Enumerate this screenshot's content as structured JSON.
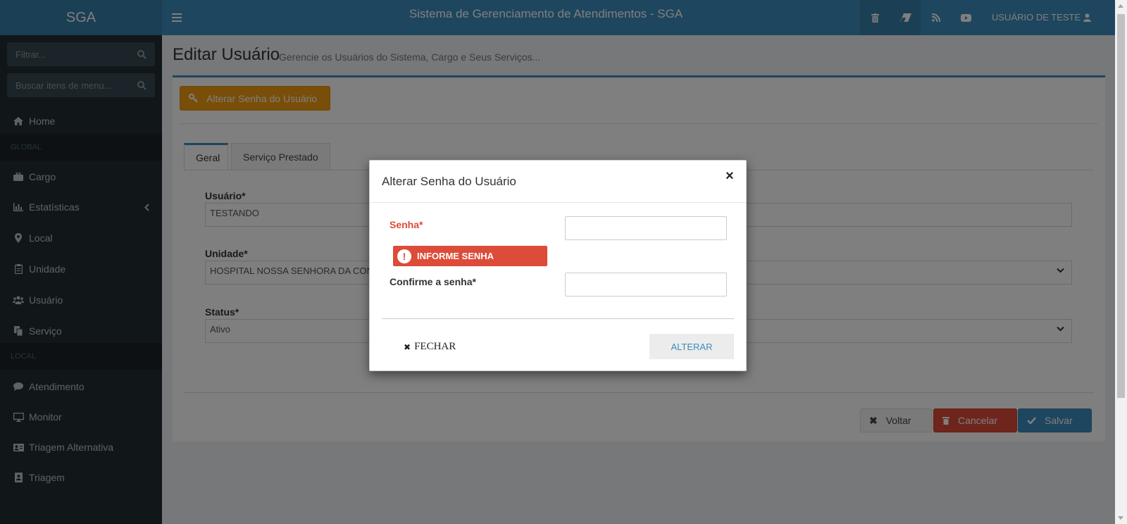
{
  "header": {
    "brand": "SGA",
    "title": "Sistema de Gerenciamento de Atendimentos - SGA",
    "user": "USUÁRIO DE TESTE",
    "icons": [
      "trash-icon",
      "eraser-icon",
      "rss-icon",
      "youtube-icon"
    ]
  },
  "sidebar": {
    "filter_placeholder": "Filtrar...",
    "search_placeholder": "Buscar itens de menu...",
    "home": "Home",
    "section_global": "GLOBAL",
    "global_items": [
      {
        "label": "Cargo",
        "icon": "briefcase-icon"
      },
      {
        "label": "Estatísticas",
        "icon": "bar-chart-icon"
      },
      {
        "label": "Local",
        "icon": "map-marker-icon"
      },
      {
        "label": "Unidade",
        "icon": "clipboard-icon"
      },
      {
        "label": "Usuário",
        "icon": "users-icon"
      },
      {
        "label": "Serviço",
        "icon": "copy-icon"
      }
    ],
    "section_local": "LOCAL",
    "local_items": [
      {
        "label": "Atendimento",
        "icon": "comment-icon"
      },
      {
        "label": "Monitor",
        "icon": "desktop-icon"
      },
      {
        "label": "Triagem Alternativa",
        "icon": "id-card-icon"
      },
      {
        "label": "Triagem",
        "icon": "address-book-icon"
      }
    ]
  },
  "content": {
    "title": "Editar Usuário",
    "subtitle": "Gerencie os Usuários do Sistema, Cargo e Seus Serviços...",
    "change_password_button": "Alterar Senha do Usuário",
    "tabs": [
      "Geral",
      "Serviço Prestado"
    ],
    "fields": {
      "usuario_label": "Usuário*",
      "usuario_value": "TESTANDO",
      "unidade_label": "Unidade*",
      "unidade_value": "HOSPITAL NOSSA SENHORA DA CONCE",
      "status_label": "Status*",
      "status_value": "Ativo"
    },
    "buttons": {
      "back": "Voltar",
      "cancel": "Cancelar",
      "save": "Salvar"
    }
  },
  "modal": {
    "title": "Alterar Senha do Usuário",
    "close_symbol": "×",
    "password_label": "Senha*",
    "password_value": "",
    "error_text": "INFORME SENHA",
    "confirm_label": "Confirme a senha*",
    "confirm_value": "",
    "close_button": "FECHAR",
    "submit_button": "ALTERAR"
  },
  "colors": {
    "primary": "#3c8dbc",
    "danger": "#dd4b39",
    "warning": "#f39c12",
    "sidebar": "#222d32"
  }
}
